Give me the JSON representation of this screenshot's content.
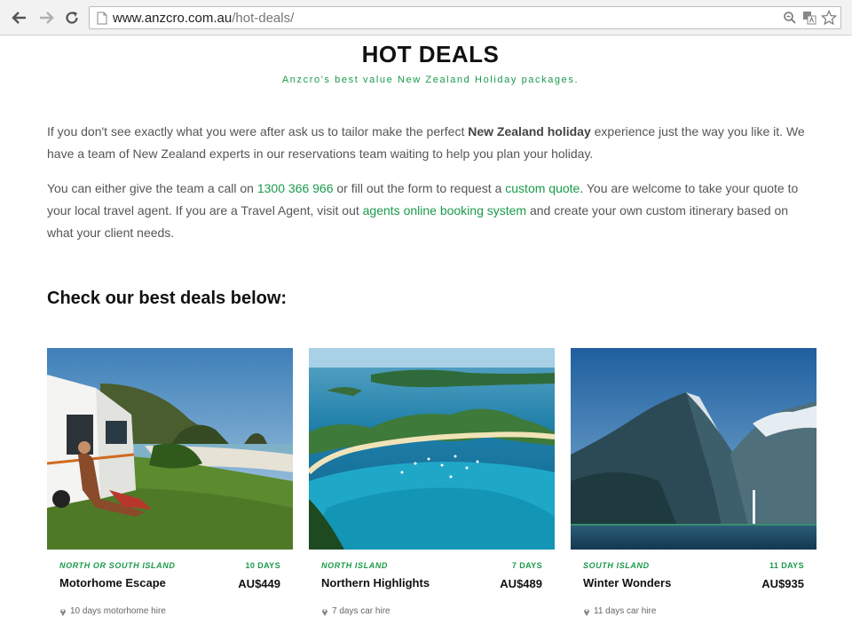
{
  "browser": {
    "url_domain": "www.anzcro.com.au",
    "url_path": "/hot-deals/"
  },
  "hero": {
    "title": "HOT DEALS",
    "subtitle": "Anzcro's best value New Zealand Holiday packages."
  },
  "intro": {
    "p1_a": "If you don't see exactly what you were after ask us to tailor make the perfect ",
    "p1_bold": "New Zealand holiday",
    "p1_b": " experience just the way you like it. We have a team of New Zealand experts in our reservations team waiting to help you plan your holiday.",
    "p2_a": "You can either give the team a call on ",
    "p2_phone": "1300 366 966",
    "p2_b": " or fill out the form to request a ",
    "p2_quote_link": "custom quote",
    "p2_c": ". You are welcome to take your quote to your local travel agent. If you are a Travel Agent, visit out ",
    "p2_agents_link": "agents online booking system",
    "p2_d": " and create your own custom itinerary based on what your client needs."
  },
  "deals_heading": "Check our best deals below:",
  "deals": [
    {
      "region": "NORTH OR SOUTH ISLAND",
      "days": "10 DAYS",
      "name": "Motorhome Escape",
      "price": "AU$449",
      "detail": "10 days motorhome hire"
    },
    {
      "region": "NORTH ISLAND",
      "days": "7 DAYS",
      "name": "Northern Highlights",
      "price": "AU$489",
      "detail": "7 days car hire"
    },
    {
      "region": "SOUTH ISLAND",
      "days": "11 DAYS",
      "name": "Winter Wonders",
      "price": "AU$935",
      "detail": "11 days car hire"
    }
  ],
  "colors": {
    "accent": "#1a9a4a",
    "heading": "#111111",
    "body_text": "#555555"
  },
  "icons": [
    "back-arrow-icon",
    "forward-arrow-icon",
    "reload-icon",
    "page-icon",
    "zoom-icon",
    "translate-icon",
    "star-icon",
    "location-pin-icon"
  ]
}
